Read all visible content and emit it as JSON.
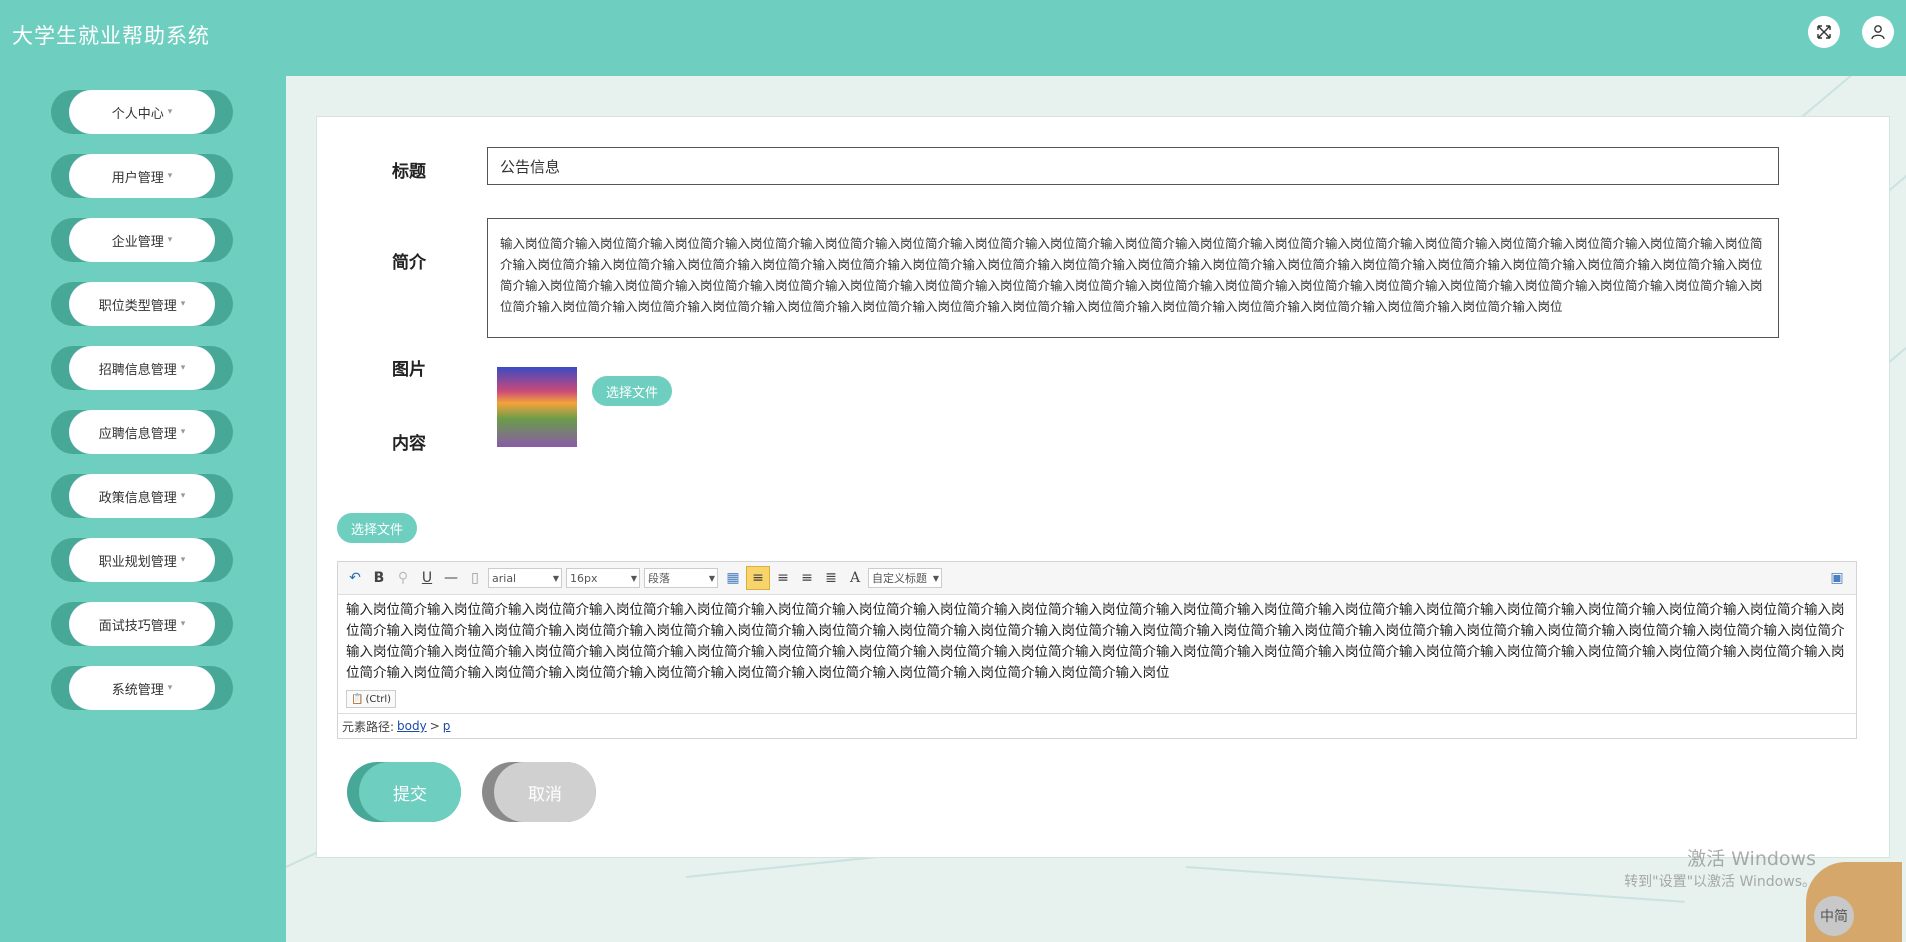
{
  "app": {
    "title": "大学生就业帮助系统"
  },
  "header_icons": [
    "expand-icon",
    "user-icon"
  ],
  "sidebar": {
    "items": [
      {
        "label": "个人中心"
      },
      {
        "label": "用户管理"
      },
      {
        "label": "企业管理"
      },
      {
        "label": "职位类型管理"
      },
      {
        "label": "招聘信息管理"
      },
      {
        "label": "应聘信息管理"
      },
      {
        "label": "政策信息管理"
      },
      {
        "label": "职业规划管理"
      },
      {
        "label": "面试技巧管理"
      },
      {
        "label": "系统管理"
      }
    ],
    "caret": "▾"
  },
  "form": {
    "title_label": "标题",
    "title_value": "公告信息",
    "summary_label": "简介",
    "summary_value": "输入岗位简介输入岗位简介输入岗位简介输入岗位简介输入岗位简介输入岗位简介输入岗位简介输入岗位简介输入岗位简介输入岗位简介输入岗位简介输入岗位简介输入岗位简介输入岗位简介输入岗位简介输入岗位简介输入岗位简介输入岗位简介输入岗位简介输入岗位简介输入岗位简介输入岗位简介输入岗位简介输入岗位简介输入岗位简介输入岗位简介输入岗位简介输入岗位简介输入岗位简介输入岗位简介输入岗位简介输入岗位简介输入岗位简介输入岗位简介输入岗位简介输入岗位简介输入岗位简介输入岗位简介输入岗位简介输入岗位简介输入岗位简介输入岗位简介输入岗位简介输入岗位简介输入岗位简介输入岗位简介输入岗位简介输入岗位简介输入岗位简介输入岗位简介输入岗位简介输入岗位简介输入岗位简介输入岗位简介输入岗位简介输入岗位简介输入岗位简介输入岗位简介输入岗位简介输入岗位简介输入岗位简介输入岗位简介输入岗位简介输入岗位简介输入岗位",
    "image_label": "图片",
    "choose_file": "选择文件",
    "content_label": "内容",
    "content_choose_file": "选择文件",
    "submit": "提交",
    "cancel": "取消"
  },
  "editor": {
    "font": "arial",
    "size": "16px",
    "paragraph": "段落",
    "custom_title": "自定义标题",
    "body": "输入岗位简介输入岗位简介输入岗位简介输入岗位简介输入岗位简介输入岗位简介输入岗位简介输入岗位简介输入岗位简介输入岗位简介输入岗位简介输入岗位简介输入岗位简介输入岗位简介输入岗位简介输入岗位简介输入岗位简介输入岗位简介输入岗位简介输入岗位简介输入岗位简介输入岗位简介输入岗位简介输入岗位简介输入岗位简介输入岗位简介输入岗位简介输入岗位简介输入岗位简介输入岗位简介输入岗位简介输入岗位简介输入岗位简介输入岗位简介输入岗位简介输入岗位简介输入岗位简介输入岗位简介输入岗位简介输入岗位简介输入岗位简介输入岗位简介输入岗位简介输入岗位简介输入岗位简介输入岗位简介输入岗位简介输入岗位简介输入岗位简介输入岗位简介输入岗位简介输入岗位简介输入岗位简介输入岗位简介输入岗位简介输入岗位简介输入岗位简介输入岗位简介输入岗位简介输入岗位简介输入岗位简介输入岗位简介输入岗位简介输入岗位简介输入岗位简介输入岗位",
    "paste_tag": "(Ctrl)",
    "path_label": "元素路径:",
    "path_body": "body",
    "path_sep": ">",
    "path_p": "p"
  },
  "watermark": {
    "line1": "激活 Windows",
    "line2": "转到\"设置\"以激活 Windows。"
  },
  "mascot_text": "中简",
  "colors": {
    "accent": "#6ecfc0",
    "accent_dark": "#48a898",
    "cancel_bg": "#d0d0d0",
    "cancel_dark": "#8a8a8a"
  }
}
